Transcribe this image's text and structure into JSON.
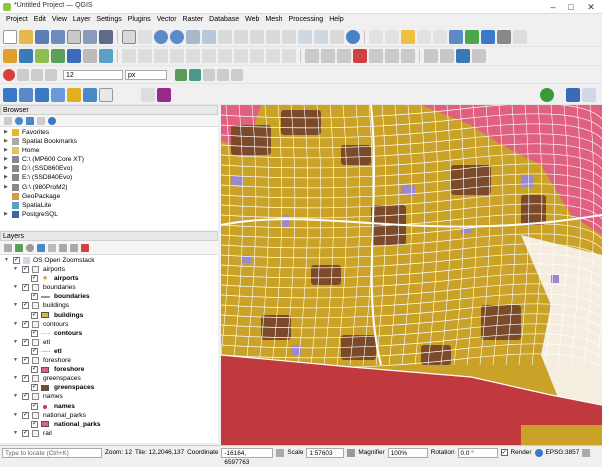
{
  "window": {
    "title": "*Untitled Project — QGIS",
    "controls": [
      "–",
      "□",
      "✕"
    ]
  },
  "menu": [
    "Project",
    "Edit",
    "View",
    "Layer",
    "Settings",
    "Plugins",
    "Vector",
    "Raster",
    "Database",
    "Web",
    "Mesh",
    "Processing",
    "Help"
  ],
  "digitizing": {
    "size_value": "12",
    "unit_value": "px"
  },
  "browser": {
    "title": "Browser",
    "items": [
      {
        "label": "Favorites",
        "icon": "star-icon",
        "expand": true
      },
      {
        "label": "Spatial Bookmarks",
        "icon": "bookmark-icon",
        "expand": true
      },
      {
        "label": "Home",
        "icon": "folder-icon",
        "expand": true
      },
      {
        "label": "C:\\ (MP600 Core XT)",
        "icon": "drive-icon",
        "expand": true
      },
      {
        "label": "D:\\ (SSD860Evo)",
        "icon": "drive-icon",
        "expand": true
      },
      {
        "label": "E:\\ (SSD840Evo)",
        "icon": "drive-icon",
        "expand": true
      },
      {
        "label": "G:\\ (980ProM2)",
        "icon": "drive-icon",
        "expand": true
      },
      {
        "label": "GeoPackage",
        "icon": "geopackage-icon",
        "expand": false
      },
      {
        "label": "SpatiaLite",
        "icon": "spatialite-icon",
        "expand": false
      },
      {
        "label": "PostgreSQL",
        "icon": "postgresql-icon",
        "expand": true
      }
    ]
  },
  "layers": {
    "title": "Layers",
    "group": "OS Open Zoomstack",
    "items": [
      {
        "label": "airports",
        "type": "group"
      },
      {
        "label": "airports",
        "type": "symbol",
        "symbol": "star",
        "color": "#d4a017"
      },
      {
        "label": "boundaries",
        "type": "group"
      },
      {
        "label": "boundaries",
        "type": "symbol",
        "symbol": "line",
        "color": "#999999"
      },
      {
        "label": "buildings",
        "type": "group"
      },
      {
        "label": "buildings",
        "type": "symbol",
        "symbol": "fill",
        "color": "#d6b84a"
      },
      {
        "label": "contours",
        "type": "group"
      },
      {
        "label": "contours",
        "type": "symbol",
        "symbol": "line",
        "color": "#dddddd"
      },
      {
        "label": "etl",
        "type": "group"
      },
      {
        "label": "etl",
        "type": "symbol",
        "symbol": "line",
        "color": "#cccccc"
      },
      {
        "label": "foreshore",
        "type": "group"
      },
      {
        "label": "foreshore",
        "type": "symbol",
        "symbol": "fill",
        "color": "#e06080"
      },
      {
        "label": "greenspaces",
        "type": "group"
      },
      {
        "label": "greenspaces",
        "type": "symbol",
        "symbol": "fill",
        "color": "#7a4a2a"
      },
      {
        "label": "names",
        "type": "group"
      },
      {
        "label": "names",
        "type": "symbol",
        "symbol": "dot",
        "color": "#cc3366"
      },
      {
        "label": "national_parks",
        "type": "group"
      },
      {
        "label": "national_parks",
        "type": "symbol",
        "symbol": "fill",
        "color": "#e06080"
      },
      {
        "label": "rail",
        "type": "group"
      }
    ]
  },
  "status": {
    "locate_placeholder": "Type to locate (Ctrl+K)",
    "zoom": "Zoom: 12",
    "tile": "Tile: 12,2046,137",
    "coordinate_label": "Coordinate",
    "coordinate_value": "-16164, 6597763",
    "scale_label": "Scale",
    "scale_value": "1:57603",
    "magnifier_label": "Magnifier",
    "magnifier_value": "100%",
    "rotation_label": "Rotation",
    "rotation_value": "0.0 °",
    "render_label": "Render",
    "crs": "EPSG:3857"
  },
  "colors": {
    "sea": "#c0393f",
    "urban": "#c9a227",
    "green": "#7a4a2a",
    "pink": "#e0607f",
    "purple": "#9b88c8",
    "road": "#ffffff"
  }
}
